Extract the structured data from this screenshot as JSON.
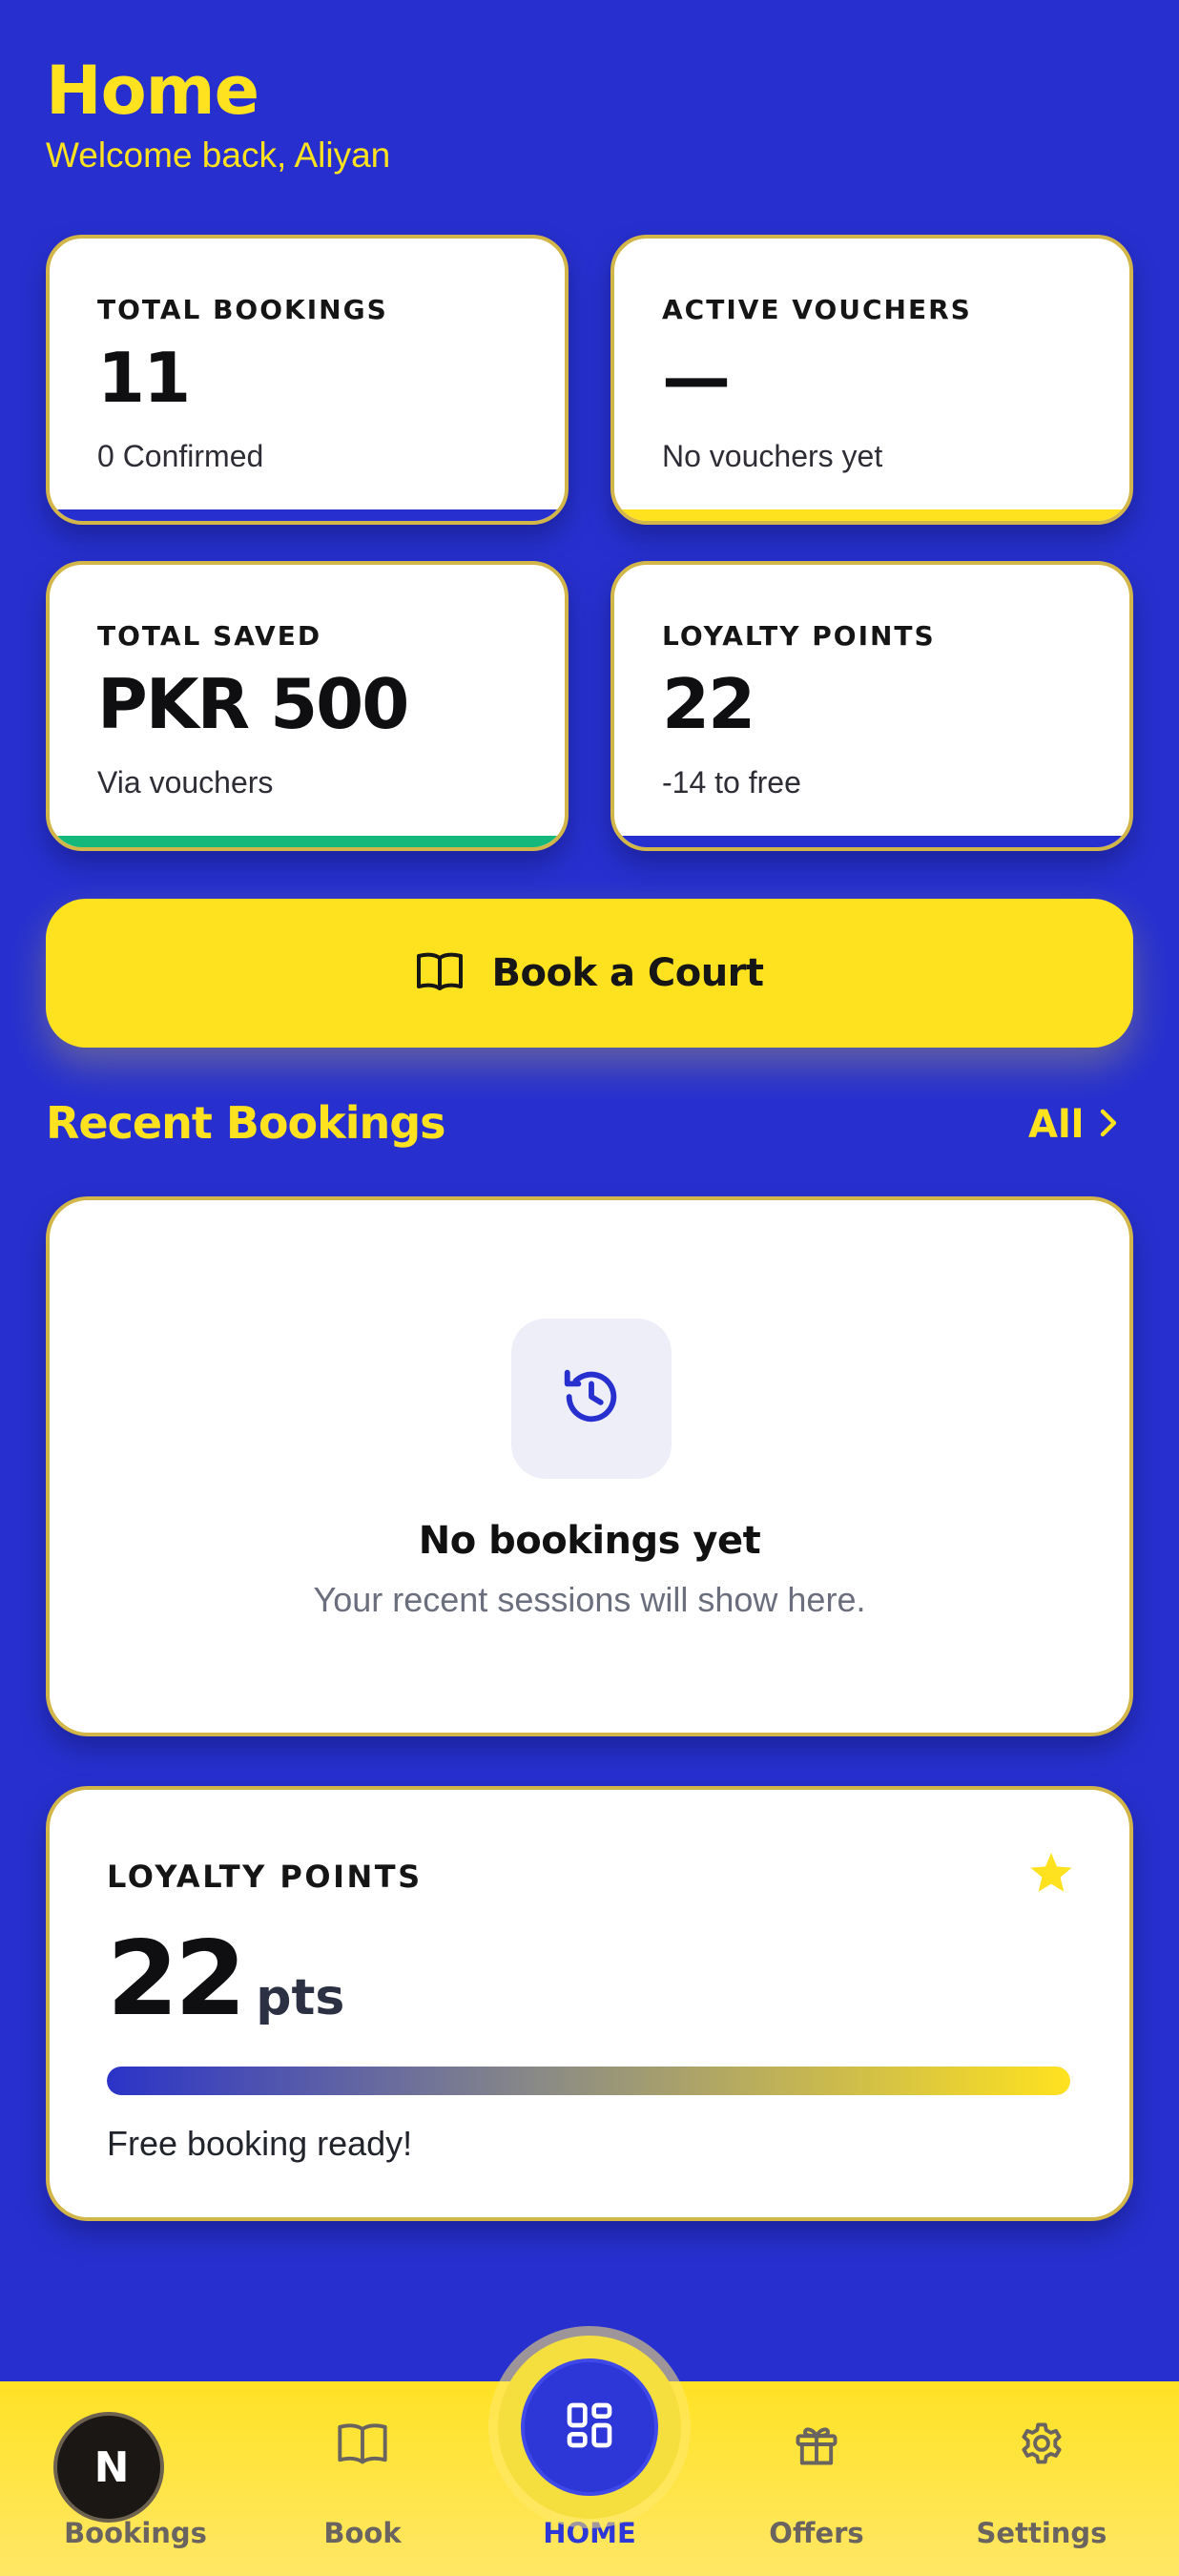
{
  "header": {
    "title": "Home",
    "welcome": "Welcome back, Aliyan"
  },
  "stats": [
    {
      "label": "TOTAL BOOKINGS",
      "value": "11",
      "sub": "0 Confirmed",
      "bar_color": "#2730cf"
    },
    {
      "label": "ACTIVE VOUCHERS",
      "value": "—",
      "sub": "No vouchers yet",
      "bar_color": "#ffe21f"
    },
    {
      "label": "TOTAL SAVED",
      "value": "PKR 500",
      "sub": "Via vouchers",
      "bar_color": "#14b87a"
    },
    {
      "label": "LOYALTY POINTS",
      "value": "22",
      "sub": "-14 to free",
      "bar_color": "#2730cf"
    }
  ],
  "book_button": {
    "label": "Book a Court",
    "icon": "book-open-icon"
  },
  "recent_bookings": {
    "title": "Recent Bookings",
    "all_label": "All",
    "empty_title": "No bookings yet",
    "empty_subtitle": "Your recent sessions will show here.",
    "icon": "history-icon"
  },
  "loyalty": {
    "label": "LOYALTY POINTS",
    "points": "22",
    "unit": "pts",
    "progress": 1.0,
    "status": "Free booking ready!",
    "icon": "star-icon"
  },
  "nav": {
    "avatar_initials": "N",
    "items": [
      {
        "label": "Bookings",
        "icon": "avatar"
      },
      {
        "label": "Book",
        "icon": "book-open-icon"
      },
      {
        "label": "HOME",
        "icon": "dashboard-grid-icon",
        "active": true
      },
      {
        "label": "Offers",
        "icon": "gift-icon"
      },
      {
        "label": "Settings",
        "icon": "gear-icon"
      }
    ]
  },
  "colors": {
    "background": "#2730cf",
    "accent": "#ffe21f",
    "card_border": "#d2b64a",
    "nav_active": "#2d36d6"
  }
}
